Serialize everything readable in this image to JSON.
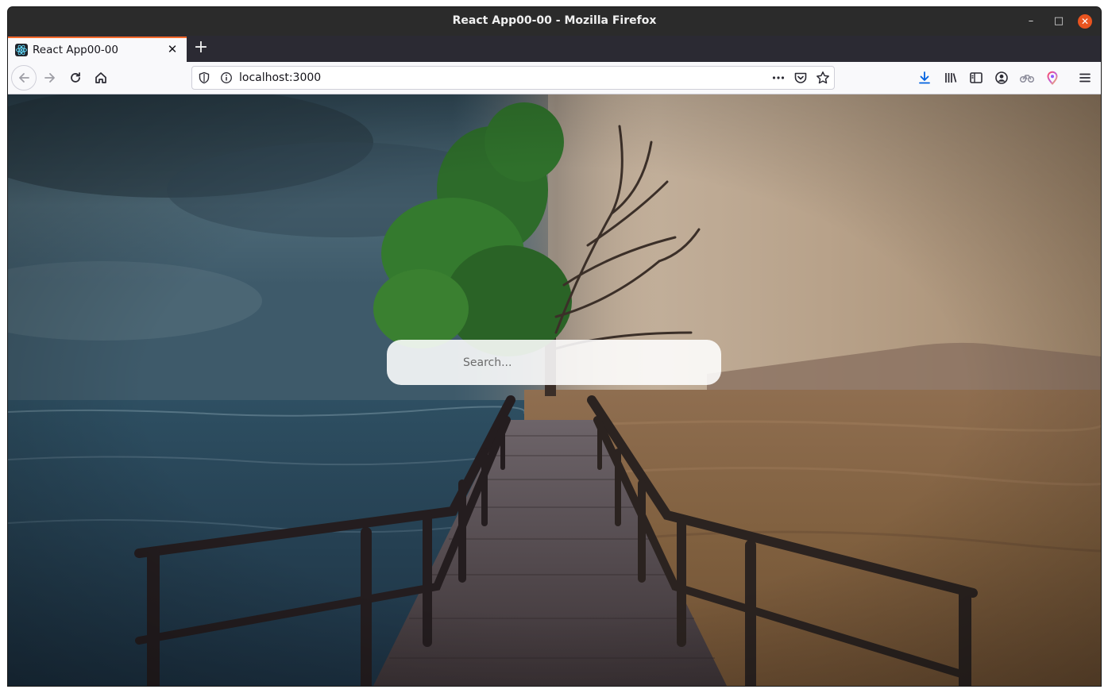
{
  "window": {
    "title": "React App00-00 - Mozilla Firefox"
  },
  "tabs": [
    {
      "label": "React App00-00",
      "active": true,
      "favicon": "react-icon"
    }
  ],
  "navigation": {
    "url": "localhost:3000"
  },
  "page": {
    "search": {
      "placeholder": "Search..."
    }
  },
  "colors": {
    "tab_accent": "#ff6a2b",
    "close_button": "#e9541f",
    "download_icon": "#0060df"
  }
}
